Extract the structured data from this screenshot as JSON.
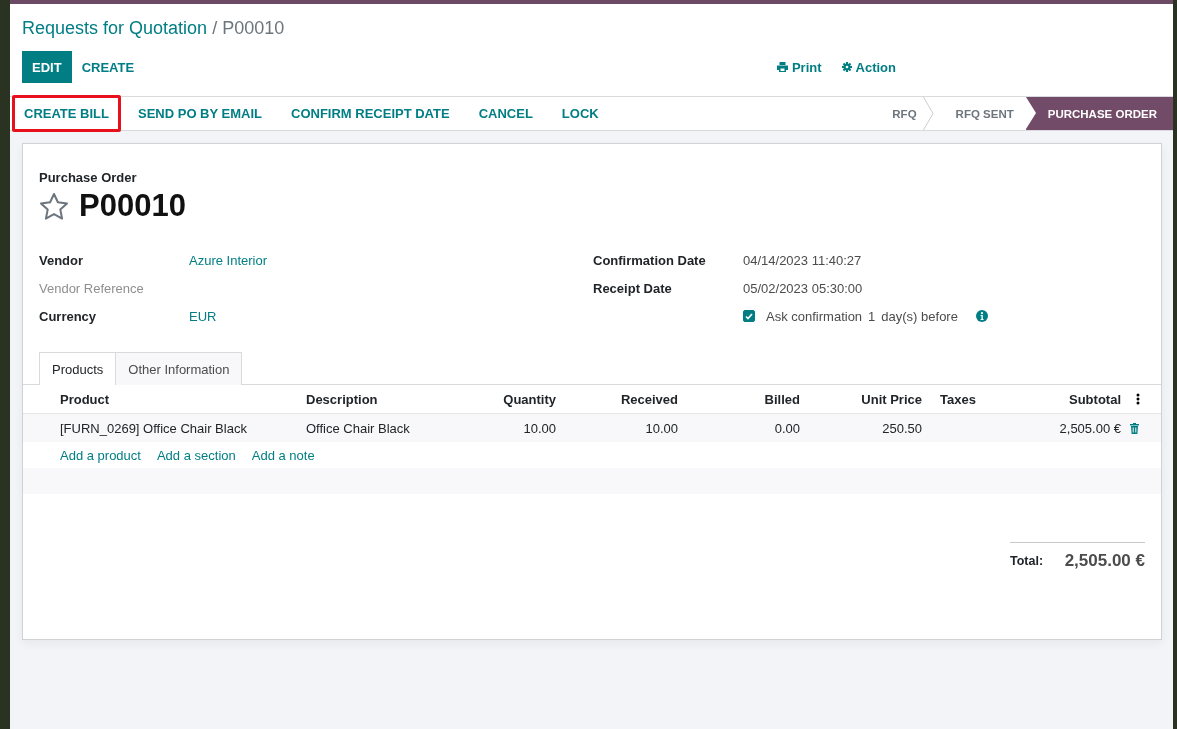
{
  "breadcrumb": {
    "parent": "Requests for Quotation",
    "separator": "/",
    "current": "P00010"
  },
  "main_buttons": [
    {
      "label": "EDIT",
      "kind": "primary"
    },
    {
      "label": "CREATE",
      "kind": "link"
    }
  ],
  "tools": [
    {
      "label": "Print",
      "kind": "print"
    },
    {
      "label": "Action",
      "kind": "action"
    }
  ],
  "header_buttons": [
    {
      "label": "CREATE BILL",
      "highlighted": true
    },
    {
      "label": "SEND PO BY EMAIL",
      "highlighted": false
    },
    {
      "label": "CONFIRM RECEIPT DATE",
      "highlighted": false
    },
    {
      "label": "CANCEL",
      "highlighted": false
    },
    {
      "label": "LOCK",
      "highlighted": false
    }
  ],
  "stages": [
    {
      "label": "RFQ",
      "selected": false
    },
    {
      "label": "RFQ SENT",
      "selected": false
    },
    {
      "label": "PURCHASE ORDER",
      "selected": true
    }
  ],
  "form": {
    "doc_type": "Purchase Order",
    "name": "P00010",
    "starred": false,
    "left_fields": [
      {
        "label": "Vendor",
        "muted": false,
        "kind": "link",
        "value": "Azure Interior"
      },
      {
        "label": "Vendor Reference",
        "muted": true,
        "kind": "empty"
      },
      {
        "label": "Currency",
        "muted": false,
        "kind": "link",
        "value": "EUR"
      }
    ],
    "right_fields": [
      {
        "label": "Confirmation Date",
        "value": "04/14/2023 11:40:27"
      },
      {
        "label": "Receipt Date",
        "value": "05/02/2023 05:30:00"
      }
    ],
    "reminder": {
      "checked": true,
      "before": "Ask confirmation",
      "days": "1",
      "after": "day(s) before"
    },
    "tabs": [
      {
        "label": "Products",
        "selected": true
      },
      {
        "label": "Other Information",
        "selected": false
      }
    ],
    "table": {
      "columns": [
        "Product",
        "Description",
        "Quantity",
        "Received",
        "Billed",
        "Unit Price",
        "Taxes",
        "Subtotal"
      ],
      "rows": [
        [
          "[FURN_0269] Office Chair Black",
          "Office Chair Black",
          "10.00",
          "10.00",
          "0.00",
          "250.50",
          "",
          "2,505.00 €"
        ]
      ],
      "add_links": [
        "Add a product",
        "Add a section",
        "Add a note"
      ]
    },
    "total": {
      "label": "Total:",
      "value": "2,505.00 €"
    }
  }
}
